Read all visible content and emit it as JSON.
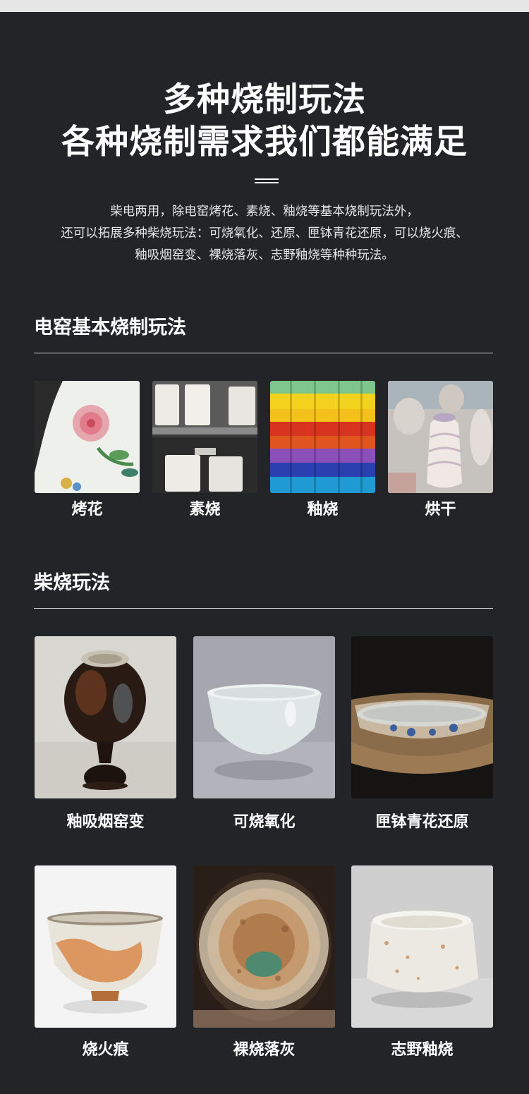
{
  "header": {
    "title_line1": "多种烧制玩法",
    "title_line2": "各种烧制需求我们都能满足"
  },
  "intro": {
    "line1": "柴电两用，除电窑烤花、素烧、釉烧等基本烧制玩法外，",
    "line2": "还可以拓展多种柴烧玩法：可烧氧化、还原、匣钵青花还原，可以烧火痕、",
    "line3": "釉吸烟窑变、裸烧落灰、志野釉烧等种种玩法。"
  },
  "section_electric": {
    "title": "电窑基本烧制玩法",
    "items": [
      {
        "label": "烤花",
        "image": "porcelain-flower-painting"
      },
      {
        "label": "素烧",
        "image": "bisque-cups-on-shelves"
      },
      {
        "label": "釉烧",
        "image": "colorful-glazed-figures"
      },
      {
        "label": "烘干",
        "image": "unfired-clay-pieces"
      }
    ]
  },
  "section_wood": {
    "title": "柴烧玩法",
    "items": [
      {
        "label": "釉吸烟窑变",
        "image": "dark-glazed-vase"
      },
      {
        "label": "可烧氧化",
        "image": "pale-celadon-bowl"
      },
      {
        "label": "匣钵青花还原",
        "image": "blue-white-bowl-in-sagger"
      },
      {
        "label": "烧火痕",
        "image": "flame-marked-cup"
      },
      {
        "label": "裸烧落灰",
        "image": "ash-glazed-cup"
      },
      {
        "label": "志野釉烧",
        "image": "shino-glazed-cup"
      }
    ]
  }
}
